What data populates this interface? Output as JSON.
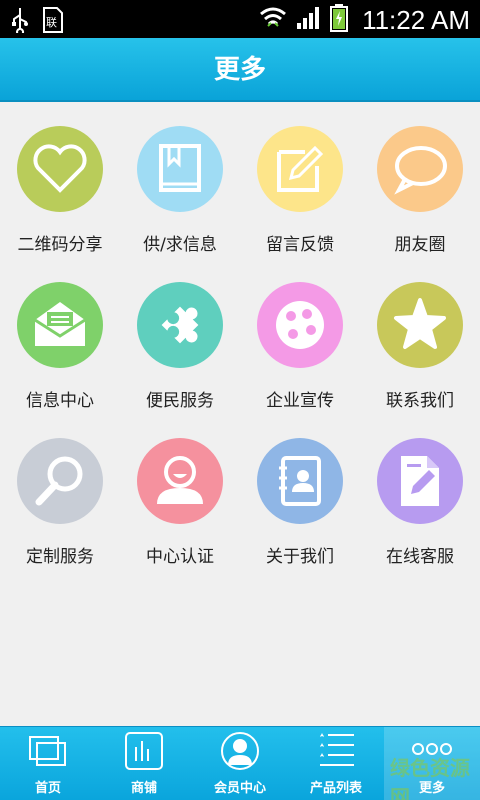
{
  "status_bar": {
    "time": "11:22 AM"
  },
  "header": {
    "title": "更多"
  },
  "grid": {
    "items": [
      {
        "label": "二维码分享",
        "color": "#b9cc5a",
        "icon": "heart-icon"
      },
      {
        "label": "供/求信息",
        "color": "#9fdcf4",
        "icon": "book-icon"
      },
      {
        "label": "留言反馈",
        "color": "#fde58a",
        "icon": "edit-icon"
      },
      {
        "label": "朋友圈",
        "color": "#fbc98a",
        "icon": "chat-bubble-icon"
      },
      {
        "label": "信息中心",
        "color": "#7fd16a",
        "icon": "envelope-icon"
      },
      {
        "label": "便民服务",
        "color": "#5fcfbe",
        "icon": "puzzle-icon"
      },
      {
        "label": "企业宣传",
        "color": "#f49ae6",
        "icon": "film-reel-icon"
      },
      {
        "label": "联系我们",
        "color": "#c8c85a",
        "icon": "star-icon"
      },
      {
        "label": "定制服务",
        "color": "#c8cdd6",
        "icon": "magnifier-icon"
      },
      {
        "label": "中心认证",
        "color": "#f5919e",
        "icon": "user-icon"
      },
      {
        "label": "关于我们",
        "color": "#8fb6e6",
        "icon": "contact-book-icon"
      },
      {
        "label": "在线客服",
        "color": "#b79bf0",
        "icon": "document-edit-icon"
      }
    ]
  },
  "tabbar": {
    "items": [
      {
        "label": "首页",
        "icon": "home-windows-icon"
      },
      {
        "label": "商铺",
        "icon": "shop-icon"
      },
      {
        "label": "会员中心",
        "icon": "member-icon"
      },
      {
        "label": "产品列表",
        "icon": "list-icon"
      },
      {
        "label": "更多",
        "icon": "more-icon",
        "active": true
      }
    ]
  },
  "watermark": "绿色资源网"
}
